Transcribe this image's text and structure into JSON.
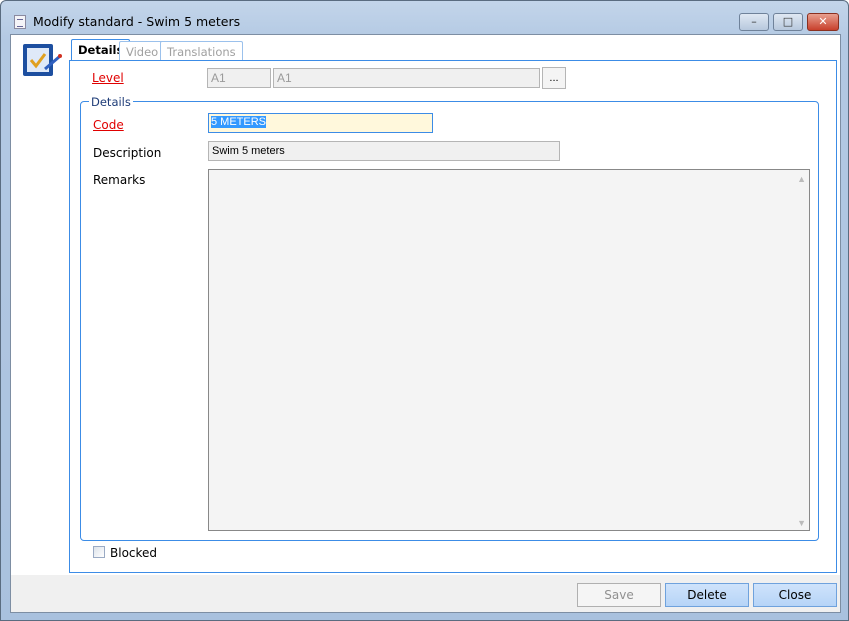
{
  "window": {
    "title": "Modify standard - Swim 5 meters",
    "minimize": "–",
    "maximize": "□",
    "close": "✕"
  },
  "tabs": [
    {
      "label": "Details",
      "active": true
    },
    {
      "label": "Video"
    },
    {
      "label": "Translations"
    }
  ],
  "level": {
    "label": "Level",
    "code": "A1",
    "name": "A1",
    "browse": "..."
  },
  "group": {
    "title": "Details"
  },
  "code": {
    "label": "Code",
    "value": "5 METERS"
  },
  "description": {
    "label": "Description",
    "value": "Swim 5 meters"
  },
  "remarks": {
    "label": "Remarks",
    "value": ""
  },
  "blocked": {
    "label": "Blocked",
    "checked": false
  },
  "buttons": {
    "save": "Save",
    "delete": "Delete",
    "close": "Close"
  },
  "colors": {
    "accent": "#3c8ce6",
    "required": "#e00000",
    "highlight": "#3399ff"
  }
}
